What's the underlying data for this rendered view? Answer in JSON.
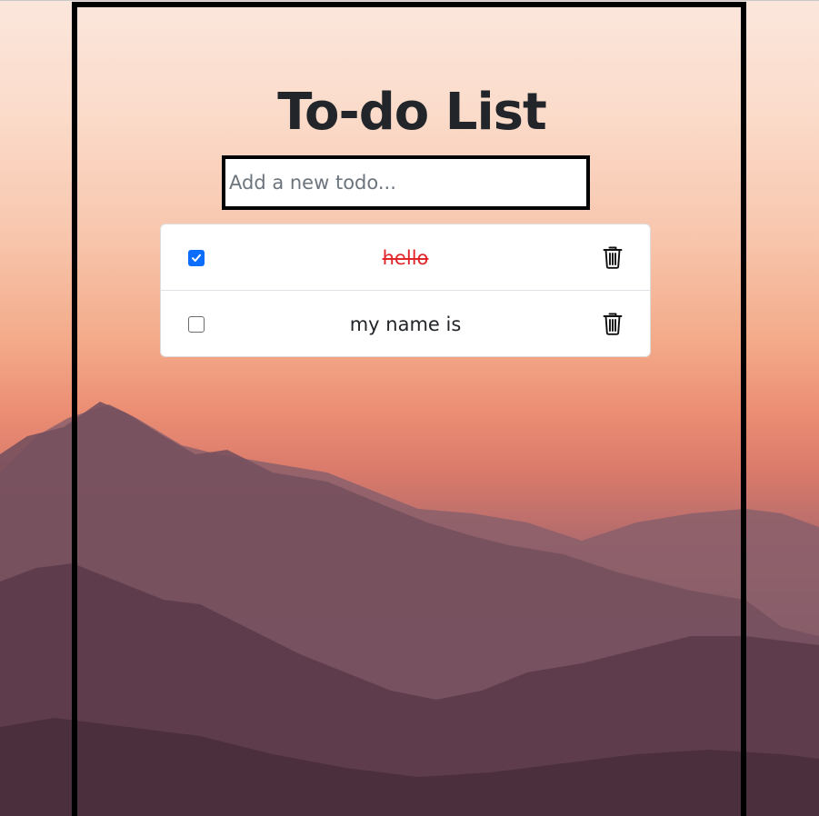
{
  "app": {
    "title": "To-do List"
  },
  "new_todo": {
    "placeholder": "Add a new todo...",
    "value": ""
  },
  "todos": [
    {
      "text": "hello",
      "completed": true,
      "delete_icon": "trash-icon"
    },
    {
      "text": "my name is",
      "completed": false,
      "delete_icon": "trash-icon"
    }
  ],
  "colors": {
    "title": "#22262b",
    "completed_text": "#e0262b",
    "checkbox_checked": "#0d6efd",
    "frame_border": "#000000"
  }
}
